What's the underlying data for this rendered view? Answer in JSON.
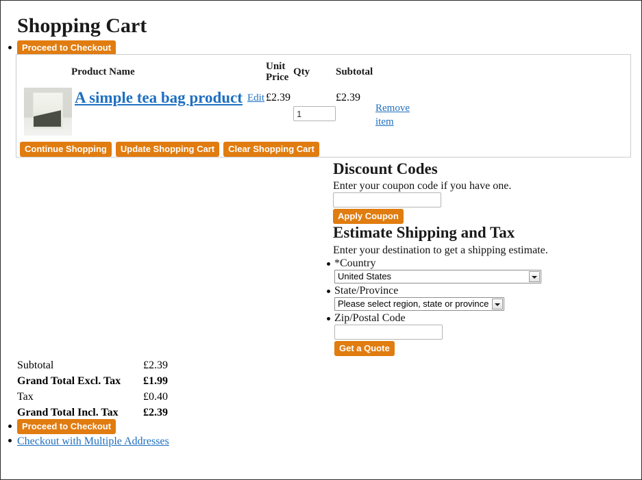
{
  "page": {
    "title": "Shopping Cart"
  },
  "checkout": {
    "top_button": "Proceed to Checkout",
    "bottom_button": "Proceed to Checkout",
    "multiple_addresses_link": "Checkout with Multiple Addresses"
  },
  "cart_table": {
    "headers": {
      "product_name": "Product Name",
      "unit_price": "Unit Price",
      "qty": "Qty",
      "subtotal": "Subtotal"
    },
    "rows": [
      {
        "thumbnail_alt": "tea-bag-product-image",
        "name": "A simple tea bag product",
        "edit_link": "Edit",
        "unit_price": "£2.39",
        "qty": "1",
        "subtotal": "£2.39",
        "remove_link": "Remove item"
      }
    ]
  },
  "cart_actions": {
    "continue_shopping": "Continue Shopping",
    "update_cart": "Update Shopping Cart",
    "clear_cart": "Clear Shopping Cart"
  },
  "discount": {
    "title": "Discount Codes",
    "note": "Enter your coupon code if you have one.",
    "input_value": "",
    "input_placeholder": "",
    "apply_button": "Apply Coupon"
  },
  "shipping": {
    "title": "Estimate Shipping and Tax",
    "note": "Enter your destination to get a shipping estimate.",
    "country_label": "*Country",
    "country_value": "United States",
    "state_label": "State/Province",
    "state_value": "Please select region, state or province",
    "zip_label": "Zip/Postal Code",
    "zip_value": "",
    "zip_placeholder": "",
    "quote_button": "Get a Quote"
  },
  "totals": {
    "rows": [
      {
        "label": "Subtotal",
        "amount": "£2.39",
        "bold": false
      },
      {
        "label": "Grand Total Excl. Tax",
        "amount": "£1.99",
        "bold": true
      },
      {
        "label": "Tax",
        "amount": "£0.40",
        "bold": false
      },
      {
        "label": "Grand Total Incl. Tax",
        "amount": "£2.39",
        "bold": true
      }
    ]
  },
  "colors": {
    "button_orange": "#e07c10",
    "link_blue": "#1e6fbf",
    "table_border": "#cccccc",
    "page_border": "#2b2b2b"
  }
}
